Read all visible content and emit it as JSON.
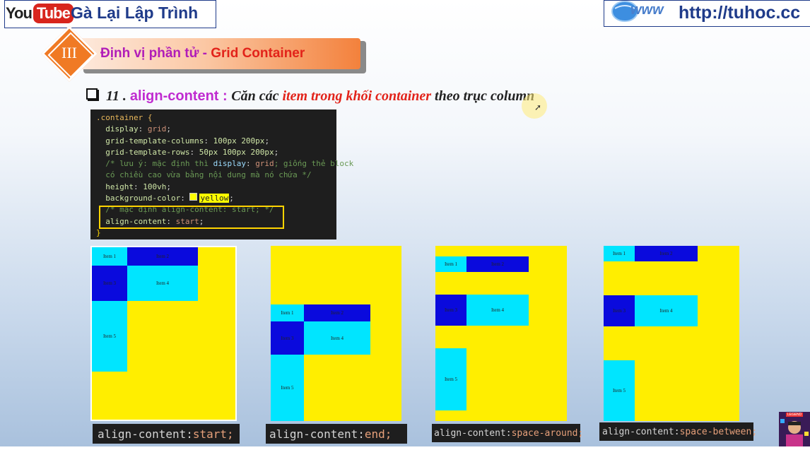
{
  "header": {
    "yt_you": "You",
    "yt_tube": "Tube",
    "channel_name": "Gà Lại Lập Trình",
    "site_url": "http://tuhoc.cc"
  },
  "banner": {
    "section_number": "III",
    "title_part1": "Định vị phần tử - ",
    "title_part2": "Grid Container"
  },
  "heading": {
    "number": "11 . ",
    "property": "align-content : ",
    "text1": "Căn các ",
    "text2": "item trong khối container",
    "text3": " theo trục column"
  },
  "code": {
    "l1_sel": ".container {",
    "l2_prop": "  display",
    "l2_val": "grid",
    "l3_prop": "  grid-template-columns",
    "l3_val": "100px 200px",
    "l4_prop": "  grid-template-rows",
    "l4_val": "50px 100px 200px",
    "l5_comment_a": "  /* lưu ý: mặc định thì ",
    "l5_kw": "display",
    "l5_kw_val": "grid",
    "l5_comment_b": "; giống thẻ block",
    "l6_comment": "  có chiều cao vừa bằng nội dung mà nó chứa */",
    "l7_prop": "  height",
    "l7_val": "100vh",
    "l8_prop": "  background-color",
    "l8_val": "yellow",
    "l9_comment": "  /* mặc định align-content: start; */",
    "l10_prop": "  align-content",
    "l10_val": "start",
    "l11_brace": "}"
  },
  "item_labels": {
    "item1": "Item 1",
    "item2": "Item 2",
    "item3": "Item 3",
    "item4": "Item 4",
    "item5": "Item 5"
  },
  "demos": [
    {
      "name": "start",
      "label_key": "align-content: ",
      "label_value": "start;"
    },
    {
      "name": "end",
      "label_key": "align-content: ",
      "label_value": "end;"
    },
    {
      "name": "space-around",
      "label_key": "align-content: ",
      "label_value": "space-around;"
    },
    {
      "name": "space-between",
      "label_key": "align-content: ",
      "label_value": "space-between;"
    }
  ],
  "avatar": {
    "badge": "LEGEND"
  },
  "colors": {
    "container": "#ffee00",
    "cyan_item": "#00e5ff",
    "blue_item": "#0a0add",
    "accent_orange": "#f07a24"
  }
}
